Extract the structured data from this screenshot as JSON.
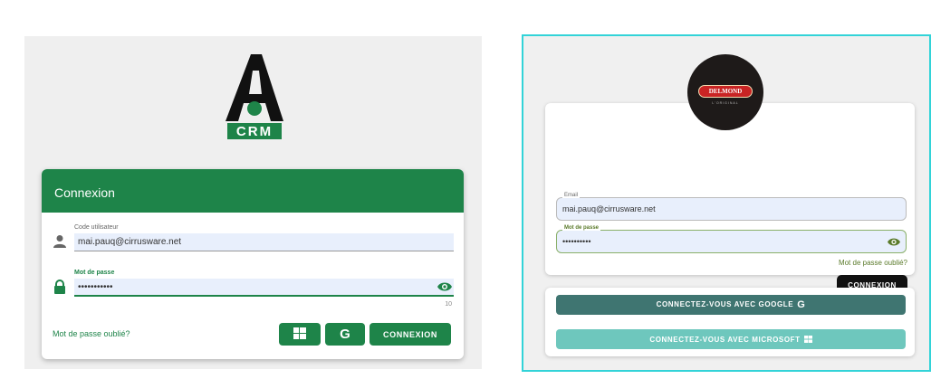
{
  "left": {
    "logo": {
      "text": "CRM",
      "icon": "crm-logo-icon"
    },
    "header_title": "Connexion",
    "user_field": {
      "label": "Code utilisateur",
      "value": "mai.pauq@cirrusware.net"
    },
    "password_field": {
      "label": "Mot de passe",
      "value": "•••••••••••",
      "counter": "10"
    },
    "forgot_link": "Mot de passe oublié?",
    "google_label": "G",
    "connexion_label": "CONNEXION"
  },
  "right": {
    "logo": {
      "brand": "DELMOND",
      "subtitle": "L'ORIGINAL"
    },
    "email_field": {
      "label": "Email",
      "value": "mai.pauq@cirrusware.net"
    },
    "password_field": {
      "label": "Mot de passe",
      "value": "••••••••••"
    },
    "forgot_link": "Mot de passe oublié?",
    "connexion_label": "CONNEXION",
    "google_button": "CONNECTEZ-VOUS AVEC GOOGLE",
    "google_glyph": "G",
    "microsoft_button": "CONNECTEZ-VOUS AVEC MICROSOFT"
  },
  "colors": {
    "green": "#1e8449",
    "teal_dark": "#3f7571",
    "teal_light": "#6ec7bd",
    "frame": "#32d3d8"
  }
}
